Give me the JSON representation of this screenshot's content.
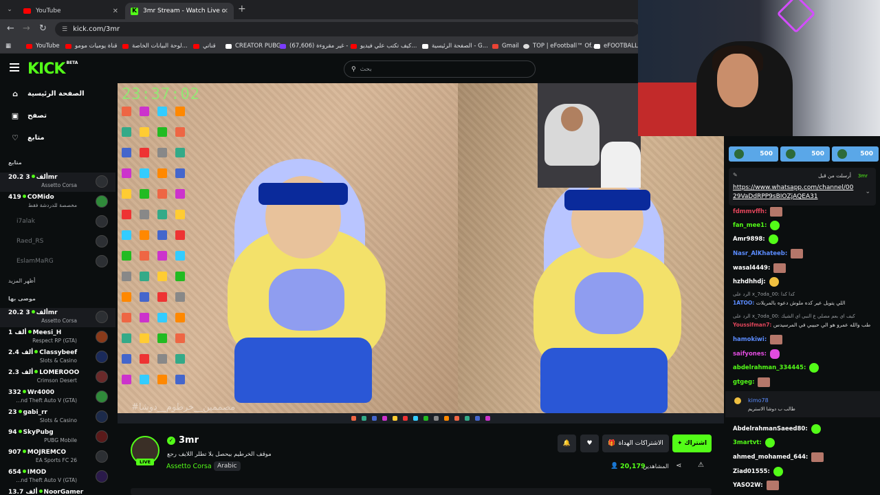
{
  "browser": {
    "tabs": [
      {
        "title": "YouTube",
        "active": false
      },
      {
        "title": "3mr Stream - Watch Live o",
        "active": true
      }
    ],
    "url": "kick.com/3mr",
    "bookmarks": [
      "YouTube",
      "قناة يوميات مومو",
      "لوحة البيانات الخاصة...",
      "قناتي",
      "CREATOR PUBG",
      "(67,606) غير مقروءة - ...",
      "كيف تكتب علي فيديو...",
      "الصفحة الرئيسية - G...",
      "Gmail",
      "TOP | eFootball™ Of...",
      "eFOOTBALL"
    ]
  },
  "kick": {
    "logo": "KICK",
    "logo_beta": "BETA",
    "search_placeholder": "بحث",
    "nav": [
      {
        "label": "الصفحة الرئيسية",
        "icon": "home-icon"
      },
      {
        "label": "تصفح",
        "icon": "browse-icon"
      },
      {
        "label": "متابع",
        "icon": "heart-icon"
      }
    ],
    "following_title": "متابع",
    "following": [
      {
        "viewers": "20.2 ألف",
        "name": "3mr",
        "category": "Assetto Corsa",
        "live": true
      },
      {
        "viewers": "419",
        "name": "COMido",
        "category": "مخصصة للدردشة فقط",
        "live": true
      },
      {
        "name": "i7alak",
        "live": false
      },
      {
        "name": "Raed_RS",
        "live": false
      },
      {
        "name": "EslamMaRG",
        "live": false
      }
    ],
    "show_more": "أظهر المزيد",
    "recommended_title": "موصى بها",
    "recommended": [
      {
        "viewers": "20.2 ألف",
        "name": "3mr",
        "category": "Assetto Corsa"
      },
      {
        "viewers": "1 ألف",
        "name": "Meesi_H",
        "category": "Respect RP (GTA)"
      },
      {
        "viewers": "2.4 ألف",
        "name": "Classybeef",
        "category": "Slots & Casino"
      },
      {
        "viewers": "2.3 ألف",
        "name": "LOMEROOO",
        "category": "Crimson Desert"
      },
      {
        "viewers": "332",
        "name": "Wr4000",
        "category": "...nd Theft Auto V (GTA)"
      },
      {
        "viewers": "23",
        "name": "gabi_rr",
        "category": "Slots & Casino"
      },
      {
        "viewers": "94",
        "name": "SkyPubg",
        "category": "PUBG Mobile"
      },
      {
        "viewers": "907",
        "name": "MOJREMCO",
        "category": "EA Sports FC 26"
      },
      {
        "viewers": "654",
        "name": "IMOD",
        "category": "...nd Theft Auto V (GTA)"
      },
      {
        "viewers": "13.7 ألف",
        "name": "NoorGamer",
        "category": ""
      }
    ]
  },
  "video": {
    "clock": "23:37:02",
    "watermark": "#مصممين__خرطوم__دوشا"
  },
  "stream": {
    "streamer": "3mr",
    "live_label": "LIVE",
    "title": "موقف الخرطيم بيحصل بلا تطلر اللايف رجع",
    "category": "Assetto Corsa",
    "language": "Arabic",
    "subscribe_label": "اشتراك",
    "gift_label": "الاشتراكات الهداة",
    "viewers": "20,179",
    "viewers_label": "المشاهدين"
  },
  "chat": {
    "gifts": [
      {
        "amount": "500"
      },
      {
        "amount": "500"
      },
      {
        "amount": "500"
      }
    ],
    "pinned_header": "أرسلت من قبل",
    "pinned_user": "3mr",
    "pinned_link": "https://www.whatsapp.com/channel/0029VaDdRPP9sBIOZjAQEA31",
    "messages": [
      {
        "user": "fdmmvffh:",
        "color": "#e0455a",
        "emote": "img"
      },
      {
        "user": "fan_mee1:",
        "color": "#53fc18",
        "emote": "green"
      },
      {
        "user": "Amr9898:",
        "color": "#ffffff",
        "emote": "green"
      },
      {
        "user": "Nasr_AlKhateeb:",
        "color": "#5b8cff",
        "emote": "img"
      },
      {
        "user": "wasal4449:",
        "color": "#ffffff",
        "emote": "img"
      },
      {
        "user": "hzhdhhdj:",
        "color": "#ffffff",
        "emote": "green"
      }
    ],
    "reply1_ctx": "الرد على x_7oda_00: كدا كدا",
    "reply1_user": "1ATOO:",
    "reply1_text": "اللي يتويل عير كده ملوش دعوه بالمريلات",
    "reply2_ctx": "الرد على x_7oda_00: كيف اي بعم مصلي ع النبي اي الشيك",
    "reply2_user": "Youssifman7:",
    "reply2_text": "طب والله عمرو هو الي حبيبي في المرسيدس",
    "messages2": [
      {
        "user": "hamokiwi:",
        "color": "#5b8cff",
        "emote": "img"
      },
      {
        "user": "saifyones:",
        "color": "#e24ce0",
        "emote": "pink"
      },
      {
        "user": "abdelrahman_334445:",
        "color": "#53fc18",
        "emote": "green"
      },
      {
        "user": "gtgeg:",
        "color": "#53fc18",
        "emote": "img"
      }
    ],
    "highlight_user": "kimo78",
    "highlight_text": "طالب ب دوشا الاستريم",
    "messages3": [
      {
        "user": "AbdelrahmanSaeed80:",
        "color": "#ffffff",
        "emote": "green"
      },
      {
        "user": "3martvt:",
        "color": "#53fc18",
        "emote": "green"
      },
      {
        "user": "ahmed_mohamed_644:",
        "color": "#ffffff",
        "emote": "img"
      },
      {
        "user": "Ziad01555:",
        "color": "#ffffff",
        "emote": "green"
      },
      {
        "user": "YASO2W:",
        "color": "#ffffff",
        "emote": "img"
      }
    ]
  },
  "colors": {
    "accent": "#53fc18",
    "bg": "#0b0e0f"
  }
}
